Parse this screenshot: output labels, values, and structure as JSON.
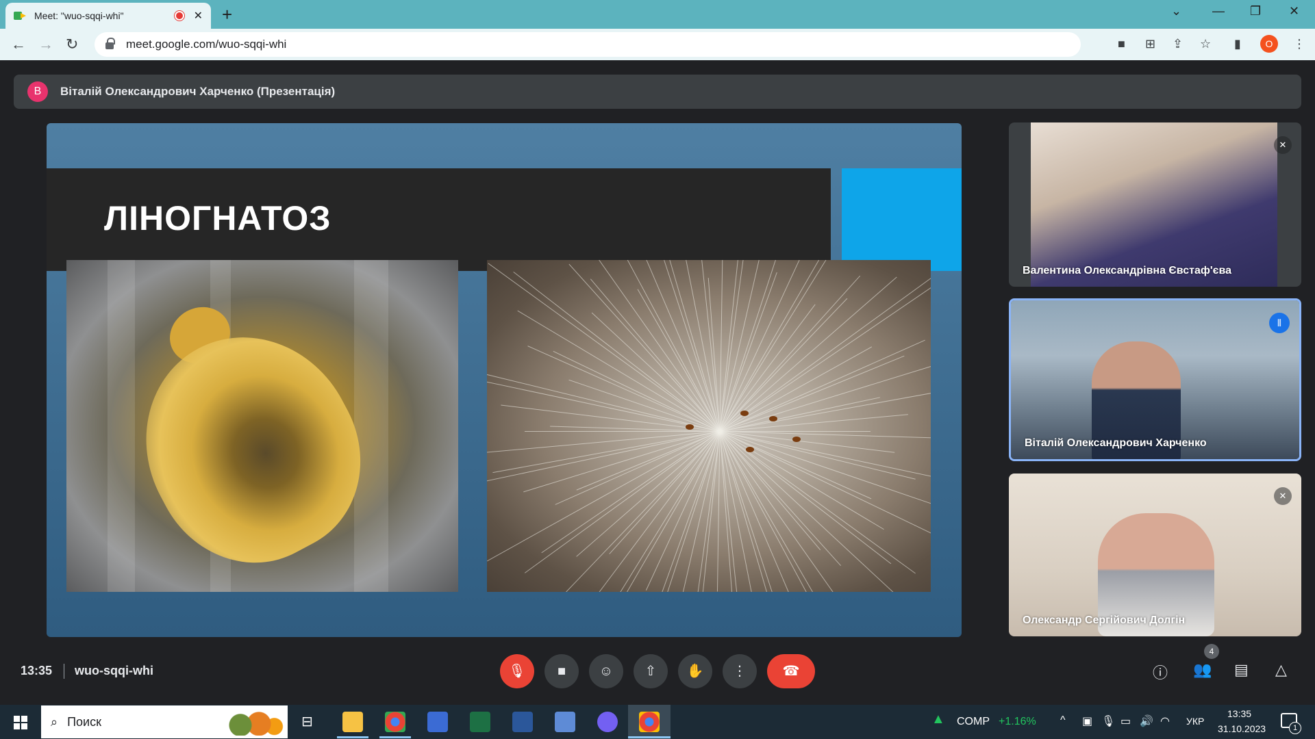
{
  "browser": {
    "tab_title": "Meet: \"wuo-sqqi-whi\"",
    "url": "meet.google.com/wuo-sqqi-whi",
    "profile_initial": "O"
  },
  "presenter": {
    "avatar_initial": "В",
    "name": "Віталій Олександрович Харченко (Презентація)"
  },
  "slide": {
    "title": "ЛІНОГНАТОЗ"
  },
  "participants": [
    {
      "name": "Валентина Олександрівна Євстаф'єва",
      "muted": true
    },
    {
      "name": "Віталій Олександрович Харченко",
      "speaking": true
    },
    {
      "name": "Олександр Сергійович Долгін",
      "muted": true
    }
  ],
  "meeting": {
    "time": "13:35",
    "code": "wuo-sqqi-whi",
    "people_count": "4"
  },
  "taskbar": {
    "search_placeholder": "Поиск",
    "stock_name": "COMP",
    "stock_change": "+1.16%",
    "language": "УКР",
    "clock_time": "13:35",
    "clock_date": "31.10.2023",
    "notification_count": "1"
  },
  "colors": {
    "accent_blue": "#0ea5e9",
    "end_call_red": "#ea4335",
    "speaking_border": "#8ab4f8"
  }
}
